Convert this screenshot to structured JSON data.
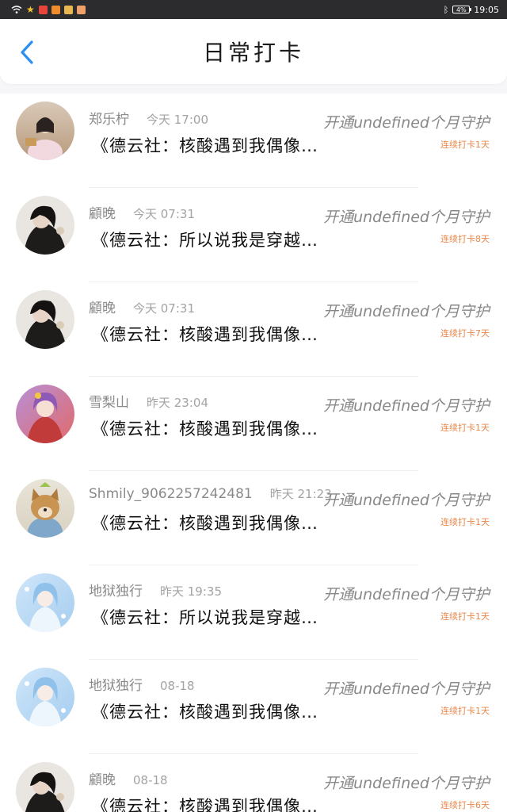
{
  "status_bar": {
    "time": "19:05",
    "battery": "4%",
    "icons": [
      "wifi-icon",
      "star-icon",
      "app-red-icon",
      "app-orange-icon",
      "app-yellow-icon",
      "app-peach-icon",
      "bluetooth-icon",
      "battery-icon"
    ]
  },
  "header": {
    "back_icon": "chevron-left-icon",
    "title": "日常打卡"
  },
  "colors": {
    "accent": "#2a8ff0",
    "streak": "#e8874b",
    "name": "#8a8a8a"
  },
  "items": [
    {
      "name": "郑乐柠",
      "time": "今天 17:00",
      "content": "《德云社：核酸遇到我偶像…",
      "guard": "开通undefined个月守护",
      "streak": "连续打卡1天",
      "avatar": "avatar-girl-pink-dress"
    },
    {
      "name": "顧晚",
      "time": "今天 07:31",
      "content": "《德云社：所以说我是穿越…",
      "guard": "开通undefined个月守护",
      "streak": "连续打卡8天",
      "avatar": "avatar-dark-hair"
    },
    {
      "name": "顧晚",
      "time": "今天 07:31",
      "content": "《德云社：核酸遇到我偶像…",
      "guard": "开通undefined个月守护",
      "streak": "连续打卡7天",
      "avatar": "avatar-dark-hair"
    },
    {
      "name": "雪梨山",
      "time": "昨天 23:04",
      "content": "《德云社：核酸遇到我偶像…",
      "guard": "开通undefined个月守护",
      "streak": "连续打卡1天",
      "avatar": "avatar-anime-purple"
    },
    {
      "name": "Shmily_9062257242481",
      "time": "昨天 21:23",
      "content": "《德云社：核酸遇到我偶像…",
      "guard": "开通undefined个月守护",
      "streak": "连续打卡1天",
      "avatar": "avatar-shiba-dog"
    },
    {
      "name": "地狱独行",
      "time": "昨天 19:35",
      "content": "《德云社：所以说我是穿越…",
      "guard": "开通undefined个月守护",
      "streak": "连续打卡1天",
      "avatar": "avatar-anime-blue"
    },
    {
      "name": "地狱独行",
      "time": "08-18",
      "content": "《德云社：核酸遇到我偶像…",
      "guard": "开通undefined个月守护",
      "streak": "连续打卡1天",
      "avatar": "avatar-anime-blue"
    },
    {
      "name": "顧晚",
      "time": "08-18",
      "content": "《德云社：核酸遇到我偶像…",
      "guard": "开通undefined个月守护",
      "streak": "连续打卡6天",
      "avatar": "avatar-dark-hair"
    }
  ]
}
